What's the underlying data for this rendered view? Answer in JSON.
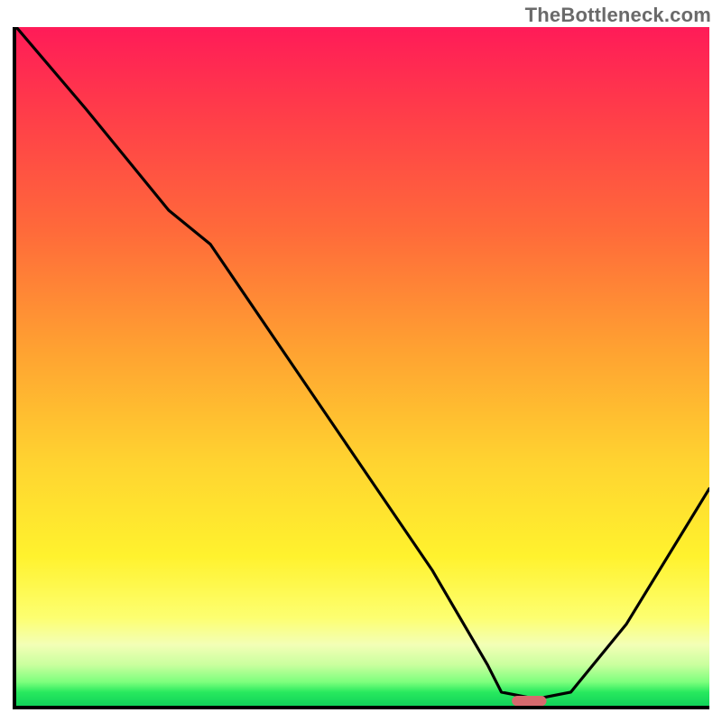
{
  "watermark": "TheBottleneck.com",
  "chart_data": {
    "type": "line",
    "title": "",
    "xlabel": "",
    "ylabel": "",
    "xlim": [
      0,
      100
    ],
    "ylim": [
      0,
      100
    ],
    "grid": false,
    "legend": false,
    "note": "Axis values are approximate percentages read off the figure by position; the plot has no numeric tick labels.",
    "series": [
      {
        "name": "bottleneck-curve",
        "x": [
          0,
          10,
          22,
          28,
          40,
          52,
          60,
          68,
          70,
          75,
          80,
          88,
          100
        ],
        "y": [
          100,
          88,
          73,
          68,
          50,
          32,
          20,
          6,
          2,
          1,
          2,
          12,
          32
        ]
      }
    ],
    "marker": {
      "name": "target-marker",
      "x": 74,
      "y": 0.7,
      "width_pct": 5,
      "height_pct": 1.5,
      "color": "#d66a6e"
    },
    "gradient_stops": [
      {
        "pos": 0.0,
        "color": "#ff1b58"
      },
      {
        "pos": 0.12,
        "color": "#ff3b4a"
      },
      {
        "pos": 0.3,
        "color": "#ff6a3a"
      },
      {
        "pos": 0.48,
        "color": "#ffa331"
      },
      {
        "pos": 0.64,
        "color": "#ffd330"
      },
      {
        "pos": 0.78,
        "color": "#fff22e"
      },
      {
        "pos": 0.87,
        "color": "#fdff70"
      },
      {
        "pos": 0.91,
        "color": "#f3ffb6"
      },
      {
        "pos": 0.94,
        "color": "#c9ff9e"
      },
      {
        "pos": 0.965,
        "color": "#7dff7d"
      },
      {
        "pos": 0.98,
        "color": "#28e95e"
      },
      {
        "pos": 1.0,
        "color": "#11d35a"
      }
    ]
  }
}
